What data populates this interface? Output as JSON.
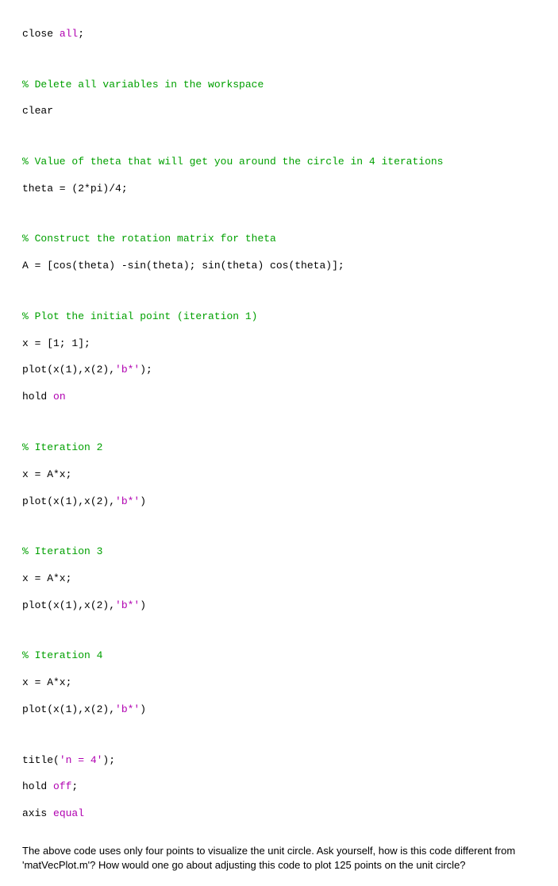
{
  "lines": {
    "l1a": "close ",
    "l1b": "all",
    "l1c": ";",
    "l2": "% Delete all variables in the workspace",
    "l3": "clear",
    "l4": "% Value of theta that will get you around the circle in 4 iterations",
    "l5": "theta = (2*pi)/4;",
    "l6": "% Construct the rotation matrix for theta",
    "l7": "A = [cos(theta) -sin(theta); sin(theta) cos(theta)];",
    "l8": "% Plot the initial point (iteration 1)",
    "l9": "x = [1; 1];",
    "l10a": "plot(x(1),x(2),",
    "l10b": "'b*'",
    "l10c": ");",
    "l11a": "hold ",
    "l11b": "on",
    "l12": "% Iteration 2",
    "l13": "x = A*x;",
    "l14a": "plot(x(1),x(2),",
    "l14b": "'b*'",
    "l14c": ")",
    "l15": "% Iteration 3",
    "l16": "x = A*x;",
    "l17a": "plot(x(1),x(2),",
    "l17b": "'b*'",
    "l17c": ")",
    "l18": "% Iteration 4",
    "l19": "x = A*x;",
    "l20a": "plot(x(1),x(2),",
    "l20b": "'b*'",
    "l20c": ")",
    "l21a": "title(",
    "l21b": "'n = 4'",
    "l21c": ");",
    "l22a": "hold ",
    "l22b": "off",
    "l22c": ";",
    "l23a": "axis ",
    "l23b": "equal"
  },
  "explanation": "The above code uses only four points to visualize the unit circle. Ask yourself, how is this code different from 'matVecPlot.m'? How would one go about adjusting this code to plot 125 points on the unit circle?"
}
